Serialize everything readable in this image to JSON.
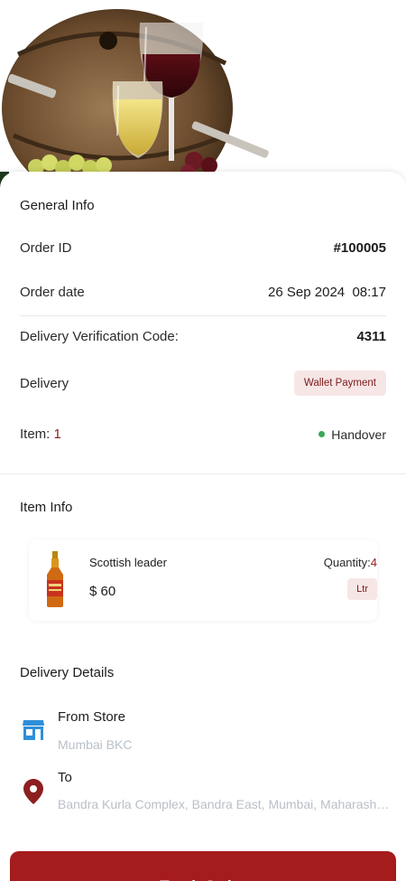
{
  "general_info": {
    "title": "General Info",
    "order_id_label": "Order ID",
    "order_id_value": "#100005",
    "order_date_label": "Order date",
    "order_date_value": "26 Sep 2024  08:17",
    "verification_label": "Delivery Verification Code:",
    "verification_value": "4311",
    "delivery_label": "Delivery",
    "payment_badge": "Wallet Payment",
    "item_label": "Item:",
    "item_count": "1",
    "status": "Handover"
  },
  "item_info": {
    "title": "Item Info",
    "name": "Scottish leader",
    "price": "$ 60",
    "quantity_label": "Quantity:",
    "quantity_value": "4",
    "unit": "Ltr"
  },
  "delivery_details": {
    "title": "Delivery Details",
    "from_title": "From Store",
    "from_value": "Mumbai BKC",
    "to_title": "To",
    "to_value": "Bandra Kurla Complex, Bandra East, Mumbai, Maharashtra"
  },
  "actions": {
    "track_order": "Track Order"
  },
  "icons": {
    "store": "store-icon",
    "location": "location-pin-icon"
  },
  "colors": {
    "accent": "#a51c1c",
    "badge_bg": "#f7e6e6",
    "status_dot": "#3aa757",
    "store_icon": "#2f8fd8",
    "pin_icon": "#8d1f1f"
  }
}
